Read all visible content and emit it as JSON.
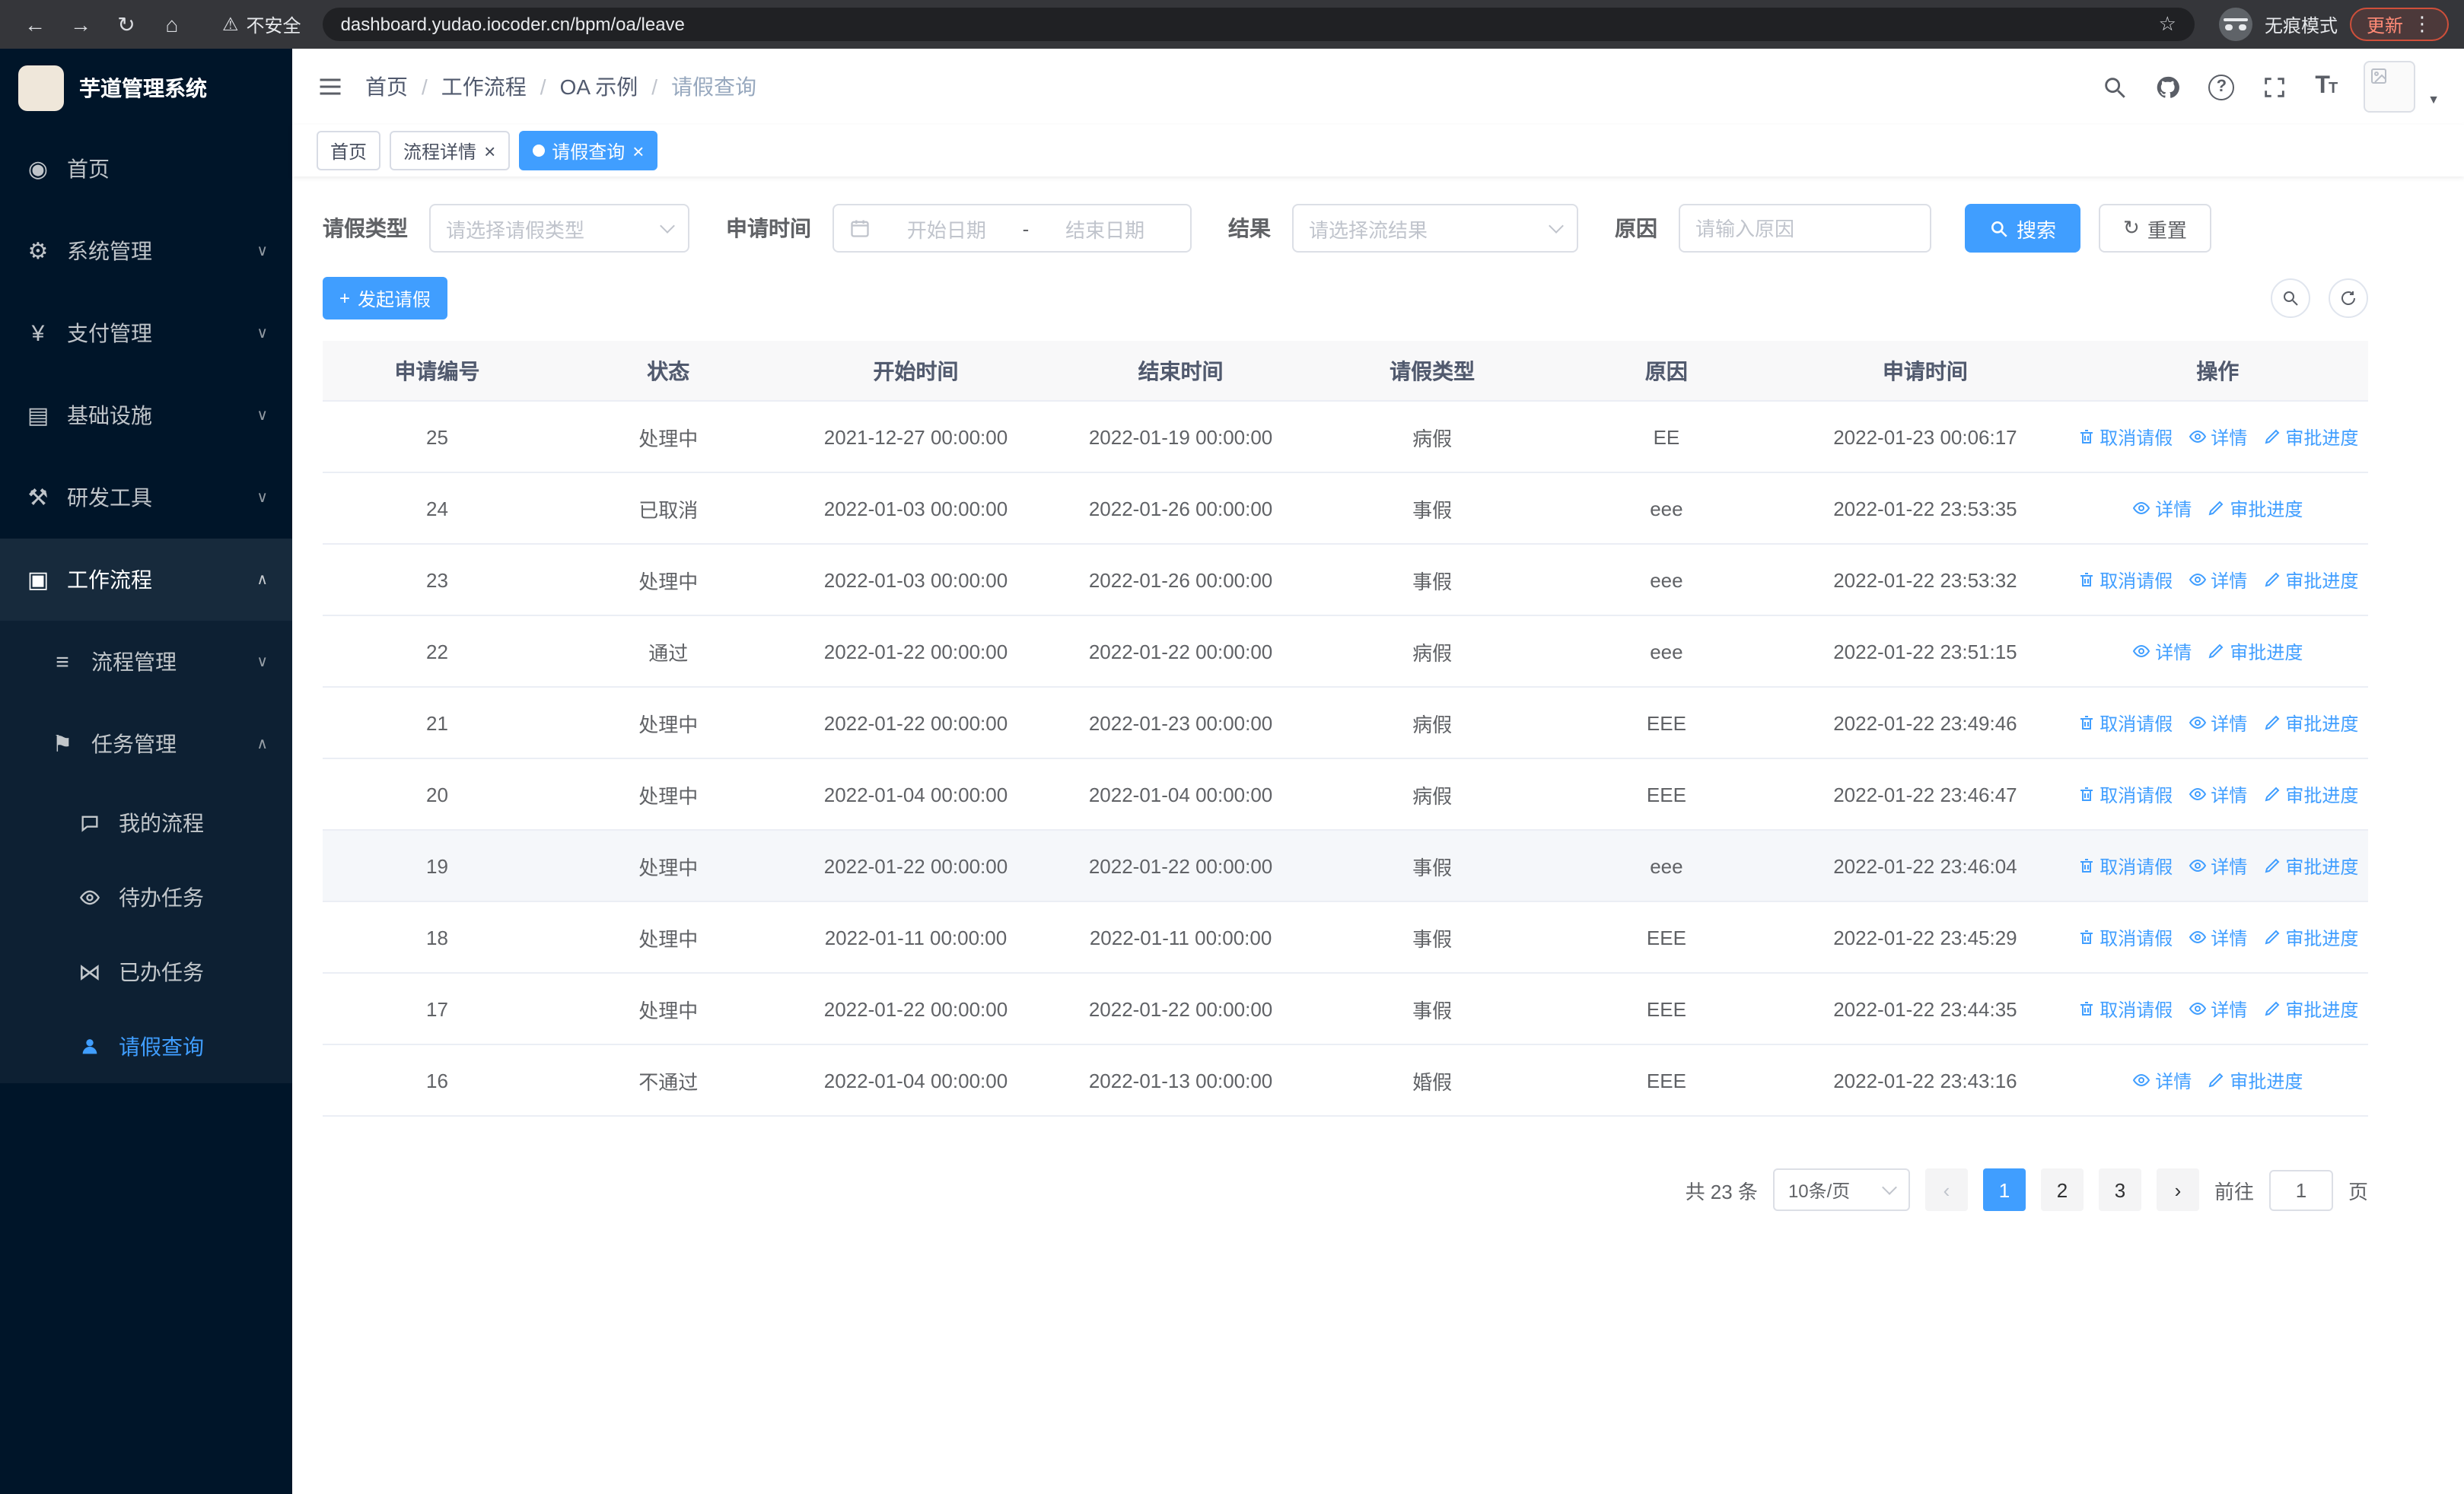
{
  "browser": {
    "url": "dashboard.yudao.iocoder.cn/bpm/oa/leave",
    "security_label": "不安全",
    "incognito_label": "无痕模式",
    "update_label": "更新"
  },
  "sidebar": {
    "logo_title": "芋道管理系统",
    "menu": [
      {
        "key": "home",
        "label": "首页",
        "icon": "dashboard-icon",
        "level": 1
      },
      {
        "key": "system",
        "label": "系统管理",
        "icon": "gear-icon",
        "level": 1,
        "chevron": "down"
      },
      {
        "key": "payment",
        "label": "支付管理",
        "icon": "yen-icon",
        "level": 1,
        "chevron": "down"
      },
      {
        "key": "infra",
        "label": "基础设施",
        "icon": "grid-icon",
        "level": 1,
        "chevron": "down"
      },
      {
        "key": "devtools",
        "label": "研发工具",
        "icon": "hammer-icon",
        "level": 1,
        "chevron": "down"
      },
      {
        "key": "workflow",
        "label": "工作流程",
        "icon": "briefcase-icon",
        "level": 1,
        "chevron": "up",
        "active_parent": true
      },
      {
        "key": "process-mgmt",
        "label": "流程管理",
        "icon": "list-icon",
        "level": 2,
        "chevron": "down"
      },
      {
        "key": "task-mgmt",
        "label": "任务管理",
        "icon": "flag-icon",
        "level": 2,
        "chevron": "up"
      },
      {
        "key": "my-process",
        "label": "我的流程",
        "icon": "chat-icon",
        "level": 3
      },
      {
        "key": "todo-tasks",
        "label": "待办任务",
        "icon": "eye-icon",
        "level": 3
      },
      {
        "key": "done-tasks",
        "label": "已办任务",
        "icon": "bowtie-icon",
        "level": 3
      },
      {
        "key": "leave-query",
        "label": "请假查询",
        "icon": "user-icon",
        "level": 3,
        "active": true
      }
    ]
  },
  "icons": {
    "dashboard-icon": "◉",
    "gear-icon": "⚙",
    "yen-icon": "¥",
    "grid-icon": "▤",
    "hammer-icon": "⚒",
    "briefcase-icon": "▣",
    "list-icon": "≡",
    "flag-icon": "⚑",
    "chat-icon": "svg:chat",
    "eye-icon": "svg:eye",
    "bowtie-icon": "⋈",
    "user-icon": "svg:user",
    "chevron-up": "∧",
    "chevron-down": "∨"
  },
  "header": {
    "breadcrumb": [
      "首页",
      "工作流程",
      "OA 示例",
      "请假查询"
    ]
  },
  "tabs": [
    {
      "key": "home",
      "label": "首页",
      "closable": false,
      "active": false
    },
    {
      "key": "process-detail",
      "label": "流程详情",
      "closable": true,
      "active": false
    },
    {
      "key": "leave-query",
      "label": "请假查询",
      "closable": true,
      "active": true
    }
  ],
  "filters": {
    "leave_type_label": "请假类型",
    "leave_type_placeholder": "请选择请假类型",
    "apply_time_label": "申请时间",
    "start_date_placeholder": "开始日期",
    "range_separator": "-",
    "end_date_placeholder": "结束日期",
    "result_label": "结果",
    "result_placeholder": "请选择流结果",
    "reason_label": "原因",
    "reason_placeholder": "请输入原因",
    "search_label": "搜索",
    "reset_label": "重置"
  },
  "toolbar": {
    "create_label": "发起请假"
  },
  "table": {
    "columns": [
      "申请编号",
      "状态",
      "开始时间",
      "结束时间",
      "请假类型",
      "原因",
      "申请时间",
      "操作"
    ],
    "actions": {
      "cancel": "取消请假",
      "detail": "详情",
      "progress": "审批进度"
    },
    "rows": [
      {
        "id": "25",
        "status": "处理中",
        "start": "2021-12-27 00:00:00",
        "end": "2022-01-19 00:00:00",
        "type": "病假",
        "reason": "EE",
        "applied": "2022-01-23 00:06:17",
        "cancellable": true,
        "highlighted": false
      },
      {
        "id": "24",
        "status": "已取消",
        "start": "2022-01-03 00:00:00",
        "end": "2022-01-26 00:00:00",
        "type": "事假",
        "reason": "eee",
        "applied": "2022-01-22 23:53:35",
        "cancellable": false,
        "highlighted": false
      },
      {
        "id": "23",
        "status": "处理中",
        "start": "2022-01-03 00:00:00",
        "end": "2022-01-26 00:00:00",
        "type": "事假",
        "reason": "eee",
        "applied": "2022-01-22 23:53:32",
        "cancellable": true,
        "highlighted": false
      },
      {
        "id": "22",
        "status": "通过",
        "start": "2022-01-22 00:00:00",
        "end": "2022-01-22 00:00:00",
        "type": "病假",
        "reason": "eee",
        "applied": "2022-01-22 23:51:15",
        "cancellable": false,
        "highlighted": false
      },
      {
        "id": "21",
        "status": "处理中",
        "start": "2022-01-22 00:00:00",
        "end": "2022-01-23 00:00:00",
        "type": "病假",
        "reason": "EEE",
        "applied": "2022-01-22 23:49:46",
        "cancellable": true,
        "highlighted": false
      },
      {
        "id": "20",
        "status": "处理中",
        "start": "2022-01-04 00:00:00",
        "end": "2022-01-04 00:00:00",
        "type": "病假",
        "reason": "EEE",
        "applied": "2022-01-22 23:46:47",
        "cancellable": true,
        "highlighted": false
      },
      {
        "id": "19",
        "status": "处理中",
        "start": "2022-01-22 00:00:00",
        "end": "2022-01-22 00:00:00",
        "type": "事假",
        "reason": "eee",
        "applied": "2022-01-22 23:46:04",
        "cancellable": true,
        "highlighted": true
      },
      {
        "id": "18",
        "status": "处理中",
        "start": "2022-01-11 00:00:00",
        "end": "2022-01-11 00:00:00",
        "type": "事假",
        "reason": "EEE",
        "applied": "2022-01-22 23:45:29",
        "cancellable": true,
        "highlighted": false
      },
      {
        "id": "17",
        "status": "处理中",
        "start": "2022-01-22 00:00:00",
        "end": "2022-01-22 00:00:00",
        "type": "事假",
        "reason": "EEE",
        "applied": "2022-01-22 23:44:35",
        "cancellable": true,
        "highlighted": false
      },
      {
        "id": "16",
        "status": "不通过",
        "start": "2022-01-04 00:00:00",
        "end": "2022-01-13 00:00:00",
        "type": "婚假",
        "reason": "EEE",
        "applied": "2022-01-22 23:43:16",
        "cancellable": false,
        "highlighted": false
      }
    ]
  },
  "pagination": {
    "total_label": "共 23 条",
    "page_size_label": "10条/页",
    "pages": [
      "1",
      "2",
      "3"
    ],
    "active_page": "1",
    "goto_label": "前往",
    "goto_value": "1",
    "page_label": "页"
  }
}
